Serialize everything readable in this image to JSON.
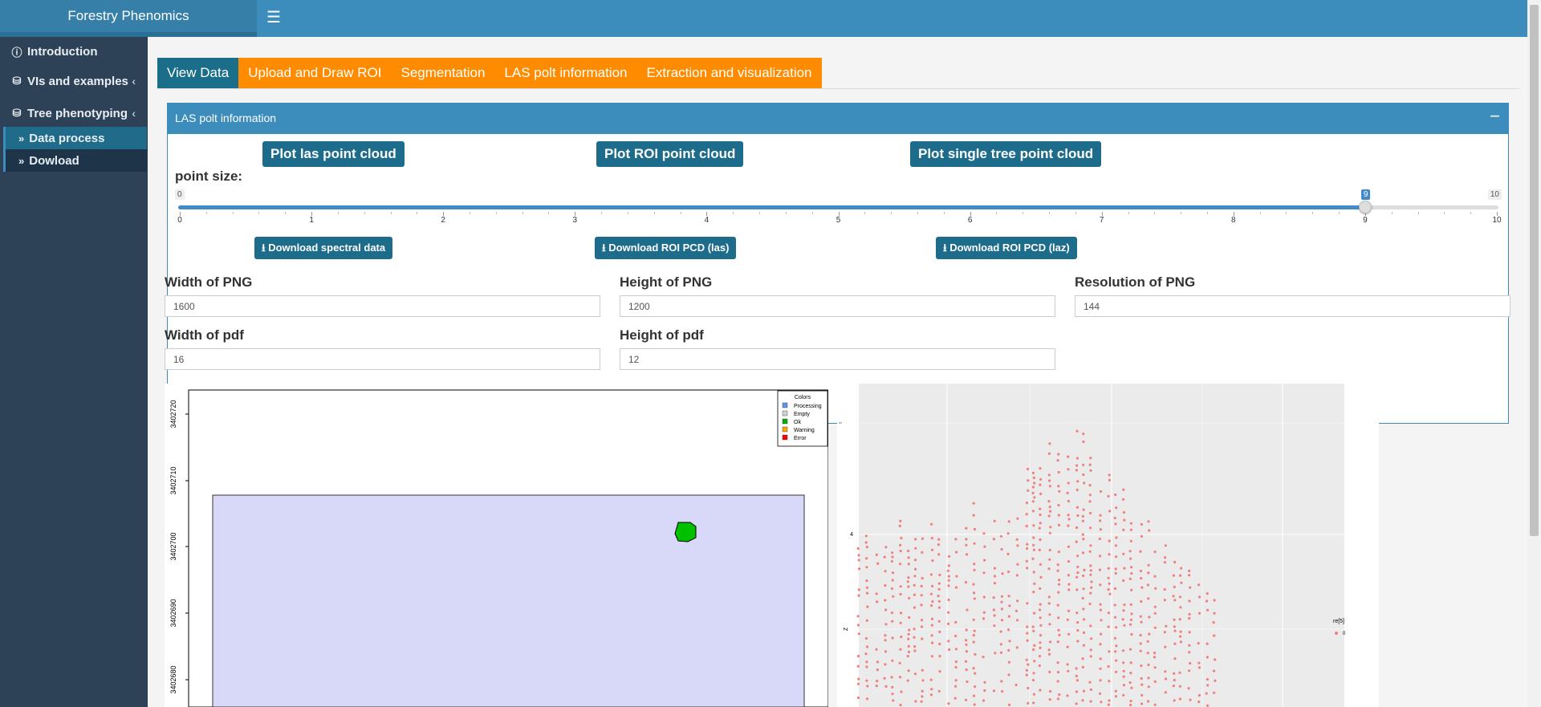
{
  "app": {
    "title": "Forestry Phenomics",
    "menu_icon": "hamburger-icon"
  },
  "sidebar": {
    "items": [
      {
        "label": "Introduction",
        "icon": "info-circle-icon"
      },
      {
        "label": "VIs and examples",
        "icon": "database-icon"
      },
      {
        "label": "Tree phenotyping",
        "icon": "database-icon"
      }
    ],
    "subitems": [
      {
        "label": "Data process",
        "icon": "double-chevron-right-icon",
        "active": true
      },
      {
        "label": "Dowload",
        "icon": "double-chevron-right-icon",
        "active": false
      }
    ]
  },
  "tabs": [
    "View Data",
    "Upload and Draw ROI",
    "Segmentation",
    "LAS polt information",
    "Extraction and visualization"
  ],
  "tab_colors": {
    "active": "#1a6e8a",
    "inactive": "#ff8c00"
  },
  "box": {
    "title": "LAS polt information",
    "collapse": "−",
    "plot_buttons": [
      "Plot las point cloud",
      "Plot ROI point cloud",
      "Plot single tree point cloud"
    ],
    "point_size": {
      "label": "point size:",
      "min": 0,
      "max": 10,
      "value": 9,
      "min_label": "0",
      "max_label": "10",
      "value_label": "9",
      "ticks": [
        "0",
        "1",
        "2",
        "3",
        "4",
        "5",
        "6",
        "7",
        "8",
        "9",
        "10"
      ]
    },
    "download_buttons": [
      "Download spectral data",
      "Download ROI PCD (las)",
      "Download ROI PCD (laz)"
    ],
    "fields": {
      "png_width": {
        "label": "Width of PNG",
        "value": "1600"
      },
      "png_height": {
        "label": "Height of PNG",
        "value": "1200"
      },
      "png_resolution": {
        "label": "Resolution of PNG",
        "value": "144"
      },
      "pdf_width": {
        "label": "Width of pdf",
        "value": "16"
      },
      "pdf_height": {
        "label": "Height of pdf",
        "value": "12"
      }
    }
  },
  "roi_plot": {
    "y_ticks": [
      "3402720",
      "3402710",
      "3402700",
      "3402690",
      "3402680"
    ],
    "legend_title": "Colors",
    "legend": [
      {
        "label": "Processing",
        "color": "#6495ed"
      },
      {
        "label": "Empty",
        "color": "#d3d3d3"
      },
      {
        "label": "Ok",
        "color": "#00b000"
      },
      {
        "label": "Warning",
        "color": "#ffa500"
      },
      {
        "label": "Error",
        "color": "#ff0000"
      }
    ],
    "roi_fill": "#d8d8f8",
    "tile_fill": "#00c000"
  },
  "scatter_plot": {
    "y_label": "Z",
    "y_ticks": [
      "4",
      "2"
    ],
    "legend_title": "re[5]",
    "legend_label": "0",
    "point_color": "#f08080"
  }
}
